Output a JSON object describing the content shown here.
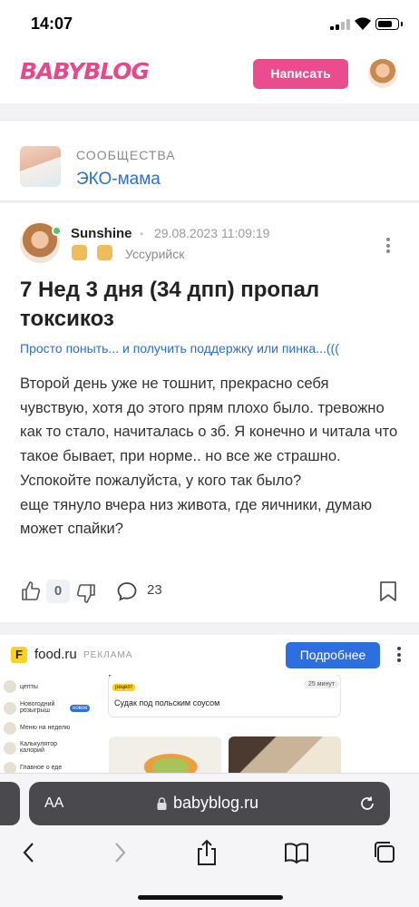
{
  "status_bar": {
    "time": "14:07"
  },
  "header": {
    "logo": "BABYBLOG",
    "write_button": "Написать"
  },
  "community": {
    "caption": "СООБЩЕСТВА",
    "name": "ЭКО-мама"
  },
  "post": {
    "author": "Sunshine",
    "date": "29.08.2023 11:09:19",
    "city": "Уссурийск",
    "title": "7 Нед 3 дня (34 дпп) пропал токсикоз",
    "subtitle": "Просто поныть... и получить поддержку или пинка...(((",
    "body": [
      "Второй день уже не тошнит, прекрасно себя чувствую, хотя до этого прям плохо было. тревожно как то стало, начиталась о зб. Я конечно и читала что такое бывает, при норме.. но все же страшно. Успокойте пожалуйста, у кого так было?",
      "еще тянуло вчера низ живота, где яичники, думаю может спайки?"
    ],
    "likes": "0",
    "comments": "23"
  },
  "ad": {
    "logo_letter": "F",
    "site": "food.ru",
    "label": "РЕКЛАМА",
    "button": "Подробнее",
    "preview": {
      "menu": [
        "цепты",
        "Новогодний розыгрыш",
        "Меню на неделю",
        "Калькулятор калорий",
        "Главное о еде"
      ],
      "new_tag": "новое",
      "recipe_tag": "рецепт",
      "dish": "Судак под польским соусом",
      "minutes": "25 минут"
    }
  },
  "browser": {
    "text_size": "AA",
    "url": "babyblog.ru"
  },
  "colors": {
    "brand": "#ea4d8e",
    "link": "#2b6fd6",
    "ad_button": "#2e6fe0"
  }
}
